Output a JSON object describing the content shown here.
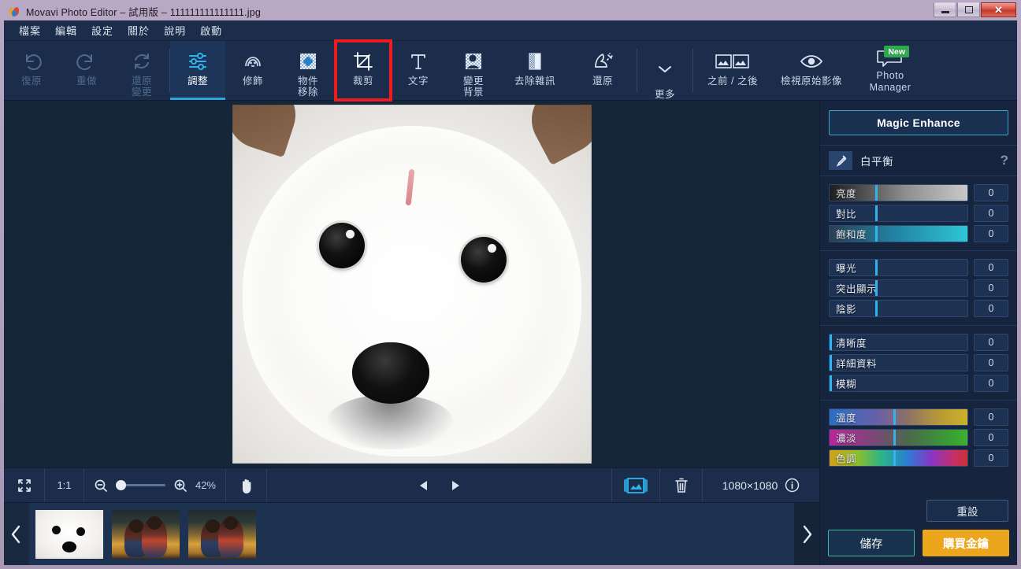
{
  "window": {
    "title": "Movavi Photo Editor – 試用版 – 111111111111111.jpg",
    "app_icon": "movavi-logo-icon",
    "controls": {
      "minimize": "minimize-button",
      "maximize": "maximize-button",
      "close": "close-button"
    },
    "border_color": "#b0a0bd"
  },
  "menubar": {
    "items": [
      {
        "label": "檔案"
      },
      {
        "label": "編輯"
      },
      {
        "label": "設定"
      },
      {
        "label": "關於"
      },
      {
        "label": "說明"
      },
      {
        "label": "啟動"
      }
    ]
  },
  "toolbar": {
    "history": [
      {
        "label": "復原",
        "icon": "undo-icon",
        "disabled": true
      },
      {
        "label": "重做",
        "icon": "redo-icon",
        "disabled": true
      },
      {
        "label": "還原變更",
        "icon": "revert-changes-icon",
        "disabled": true
      }
    ],
    "tools": [
      {
        "label": "調整",
        "icon": "adjust-sliders-icon",
        "active": true
      },
      {
        "label": "修飾",
        "icon": "retouch-face-icon",
        "active": false
      },
      {
        "label": "物件移除",
        "icon": "object-removal-icon",
        "active": false
      },
      {
        "label": "裁剪",
        "icon": "crop-icon",
        "active": false,
        "highlighted": true
      },
      {
        "label": "文字",
        "icon": "text-icon",
        "active": false
      },
      {
        "label": "變更背景",
        "icon": "change-background-icon",
        "active": false
      },
      {
        "label": "去除雜訊",
        "icon": "denoise-icon",
        "active": false
      },
      {
        "label": "還原",
        "icon": "restore-magic-icon",
        "active": false
      }
    ],
    "more": {
      "label": "更多",
      "icon": "chevron-down-icon"
    },
    "right": [
      {
        "label": "之前 / 之後",
        "icon": "before-after-icon"
      },
      {
        "label": "檢視原始影像",
        "icon": "eye-icon"
      },
      {
        "label": "Photo Manager",
        "icon": "photo-manager-icon",
        "badge": "New",
        "badge_color": "#2fa84f"
      }
    ]
  },
  "canvas": {
    "image_alt": "white-dog-photo"
  },
  "controlbar": {
    "fit_icon": "fit-to-screen-icon",
    "one_to_one": "1:1",
    "zoom_out_icon": "zoom-out-icon",
    "zoom_in_icon": "zoom-in-icon",
    "zoom_level": "42%",
    "hand_icon": "hand-tool-icon",
    "prev_icon": "previous-image-icon",
    "next_icon": "next-image-icon",
    "compare_icon": "compare-images-icon",
    "delete_icon": "trash-icon",
    "dimensions": "1080×1080",
    "info_icon": "info-icon"
  },
  "filmstrip": {
    "prev_icon": "strip-previous-icon",
    "next_icon": "strip-next-icon",
    "thumbnails": [
      {
        "name": "thumbnail-dog",
        "selected": true
      },
      {
        "name": "thumbnail-artwork-1",
        "selected": false
      },
      {
        "name": "thumbnail-artwork-2",
        "selected": false
      }
    ]
  },
  "panel": {
    "magic_enhance": "Magic Enhance",
    "white_balance": {
      "label": "白平衡",
      "icon": "eyedropper-icon",
      "help": "?"
    },
    "groups": [
      {
        "name": "tone-group",
        "sliders": [
          {
            "label": "亮度",
            "value": "0",
            "fill": "gray",
            "pos": 33
          },
          {
            "label": "對比",
            "value": "0",
            "fill": "plain",
            "pos": 33
          },
          {
            "label": "飽和度",
            "value": "0",
            "fill": "saturation",
            "pos": 33
          }
        ]
      },
      {
        "name": "exposure-group",
        "sliders": [
          {
            "label": "曝光",
            "value": "0",
            "fill": "plain",
            "pos": 33
          },
          {
            "label": "突出顯示",
            "value": "0",
            "fill": "plain",
            "pos": 33
          },
          {
            "label": "陰影",
            "value": "0",
            "fill": "plain",
            "pos": 33
          }
        ]
      },
      {
        "name": "detail-group",
        "sliders": [
          {
            "label": "清晰度",
            "value": "0",
            "fill": "plain",
            "pos": 0
          },
          {
            "label": "詳細資料",
            "value": "0",
            "fill": "plain",
            "pos": 0
          },
          {
            "label": "模糊",
            "value": "0",
            "fill": "plain",
            "pos": 0
          }
        ]
      },
      {
        "name": "color-group",
        "sliders": [
          {
            "label": "溫度",
            "value": "0",
            "fill": "temperature",
            "pos": 46
          },
          {
            "label": "濃淡",
            "value": "0",
            "fill": "tint",
            "pos": 46
          },
          {
            "label": "色調",
            "value": "0",
            "fill": "hue",
            "pos": 46
          }
        ]
      }
    ],
    "reset": "重設",
    "save": "儲存",
    "buy": "購買金鑰",
    "accent_color": "#2fb4f0",
    "buy_color": "#eba61d"
  }
}
